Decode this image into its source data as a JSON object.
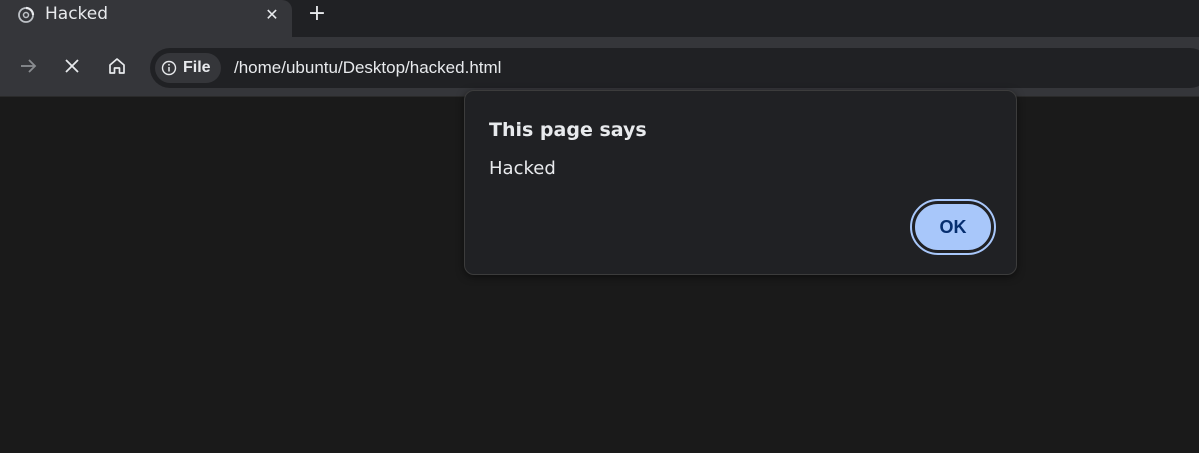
{
  "tab": {
    "title": "Hacked",
    "close_glyph": "✕",
    "favicon": "loading-spinner-icon"
  },
  "new_tab_glyph": "+",
  "toolbar": {
    "forward_icon": "arrow-right-icon",
    "stop_icon": "close-icon",
    "home_icon": "home-icon"
  },
  "omnibox": {
    "chip_icon": "info-icon",
    "chip_label": "File",
    "url": "/home/ubuntu/Desktop/hacked.html"
  },
  "dialog": {
    "title": "This page says",
    "message": "Hacked",
    "ok_label": "OK"
  },
  "colors": {
    "page_background": "#1a1a1a",
    "chrome_background": "#35363a",
    "dialog_background": "#202124",
    "ok_button_fill": "#a8c7fa",
    "ok_button_text": "#062e6f"
  }
}
